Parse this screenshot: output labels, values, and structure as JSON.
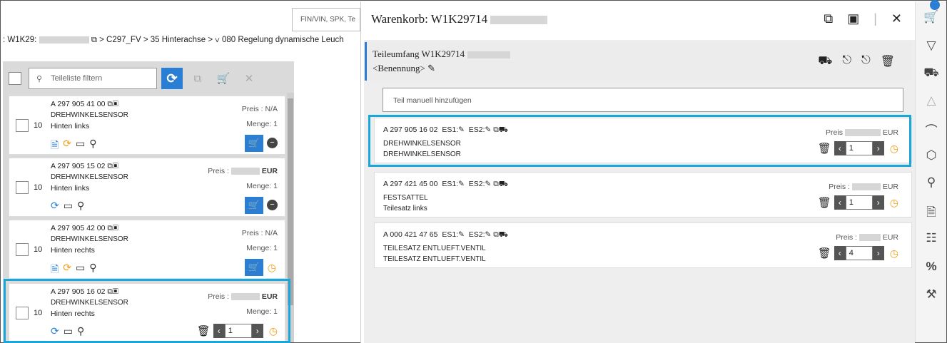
{
  "search": {
    "placeholder": "FIN/VIN, SPK, Te"
  },
  "breadcrumb": {
    "prefix": ": W1K29:",
    "sep1": "⧉ >",
    "item1": "C297_FV",
    "sep2": ">",
    "item2": "35 Hinterachse",
    "sep3": "> ∨",
    "item3": "080 Regelung dynamische Leuch"
  },
  "parts_list": {
    "filter_placeholder": "Teileliste filtern",
    "items": [
      {
        "qty": "10",
        "part_no": "A 297 905 41 00",
        "name": "DREHWINKELSENSOR",
        "sub": "Hinten links",
        "price_label": "Preis :",
        "price": "N/A",
        "menge": "Menge: 1"
      },
      {
        "qty": "10",
        "part_no": "A 297 905 15 02",
        "name": "DREHWINKELSENSOR",
        "sub": "Hinten links",
        "price_label": "Preis :",
        "price": "EUR",
        "menge": "Menge: 1"
      },
      {
        "qty": "10",
        "part_no": "A 297 905 42 00",
        "name": "DREHWINKELSENSOR",
        "sub": "Hinten rechts",
        "price_label": "Preis :",
        "price": "N/A",
        "menge": "Menge: 1"
      },
      {
        "qty": "10",
        "part_no": "A 297 905 16 02",
        "name": "DREHWINKELSENSOR",
        "sub": "Hinten rechts",
        "price_label": "Preis :",
        "price": "EUR",
        "menge": "Menge: 1",
        "stepper_value": "1"
      }
    ]
  },
  "cart": {
    "title": "Warenkorb: W1K29714",
    "scope_title": "Teileumfang W1K29714",
    "scope_sub": "<Benennung>",
    "add_placeholder": "Teil manuell hinzufügen",
    "items": [
      {
        "part_no": "A 297 905 16 02",
        "es1": "ES1:",
        "es2": "ES2:",
        "line2": "DREHWINKELSENSOR",
        "line3": "DREHWINKELSENSOR",
        "price_label": "Preis",
        "price": "EUR",
        "qty": "1"
      },
      {
        "part_no": "A 297 421 45 00",
        "es1": "ES1:",
        "es2": "ES2:",
        "line2": "FESTSATTEL",
        "line3": "Teilesatz links",
        "price_label": "Preis :",
        "price": "EUR",
        "qty": "1"
      },
      {
        "part_no": "A 000 421 47 65",
        "es1": "ES1:",
        "es2": "ES2:",
        "line2": "TEILESATZ ENTLUEFT.VENTIL",
        "line3": "TEILESATZ ENTLUEFT.VENTIL",
        "price_label": "Preis :",
        "price": "EUR",
        "qty": "4"
      }
    ]
  },
  "colors": {
    "accent": "#2a7fd4",
    "highlight": "#1aa6d8",
    "clock": "#f39c12"
  }
}
